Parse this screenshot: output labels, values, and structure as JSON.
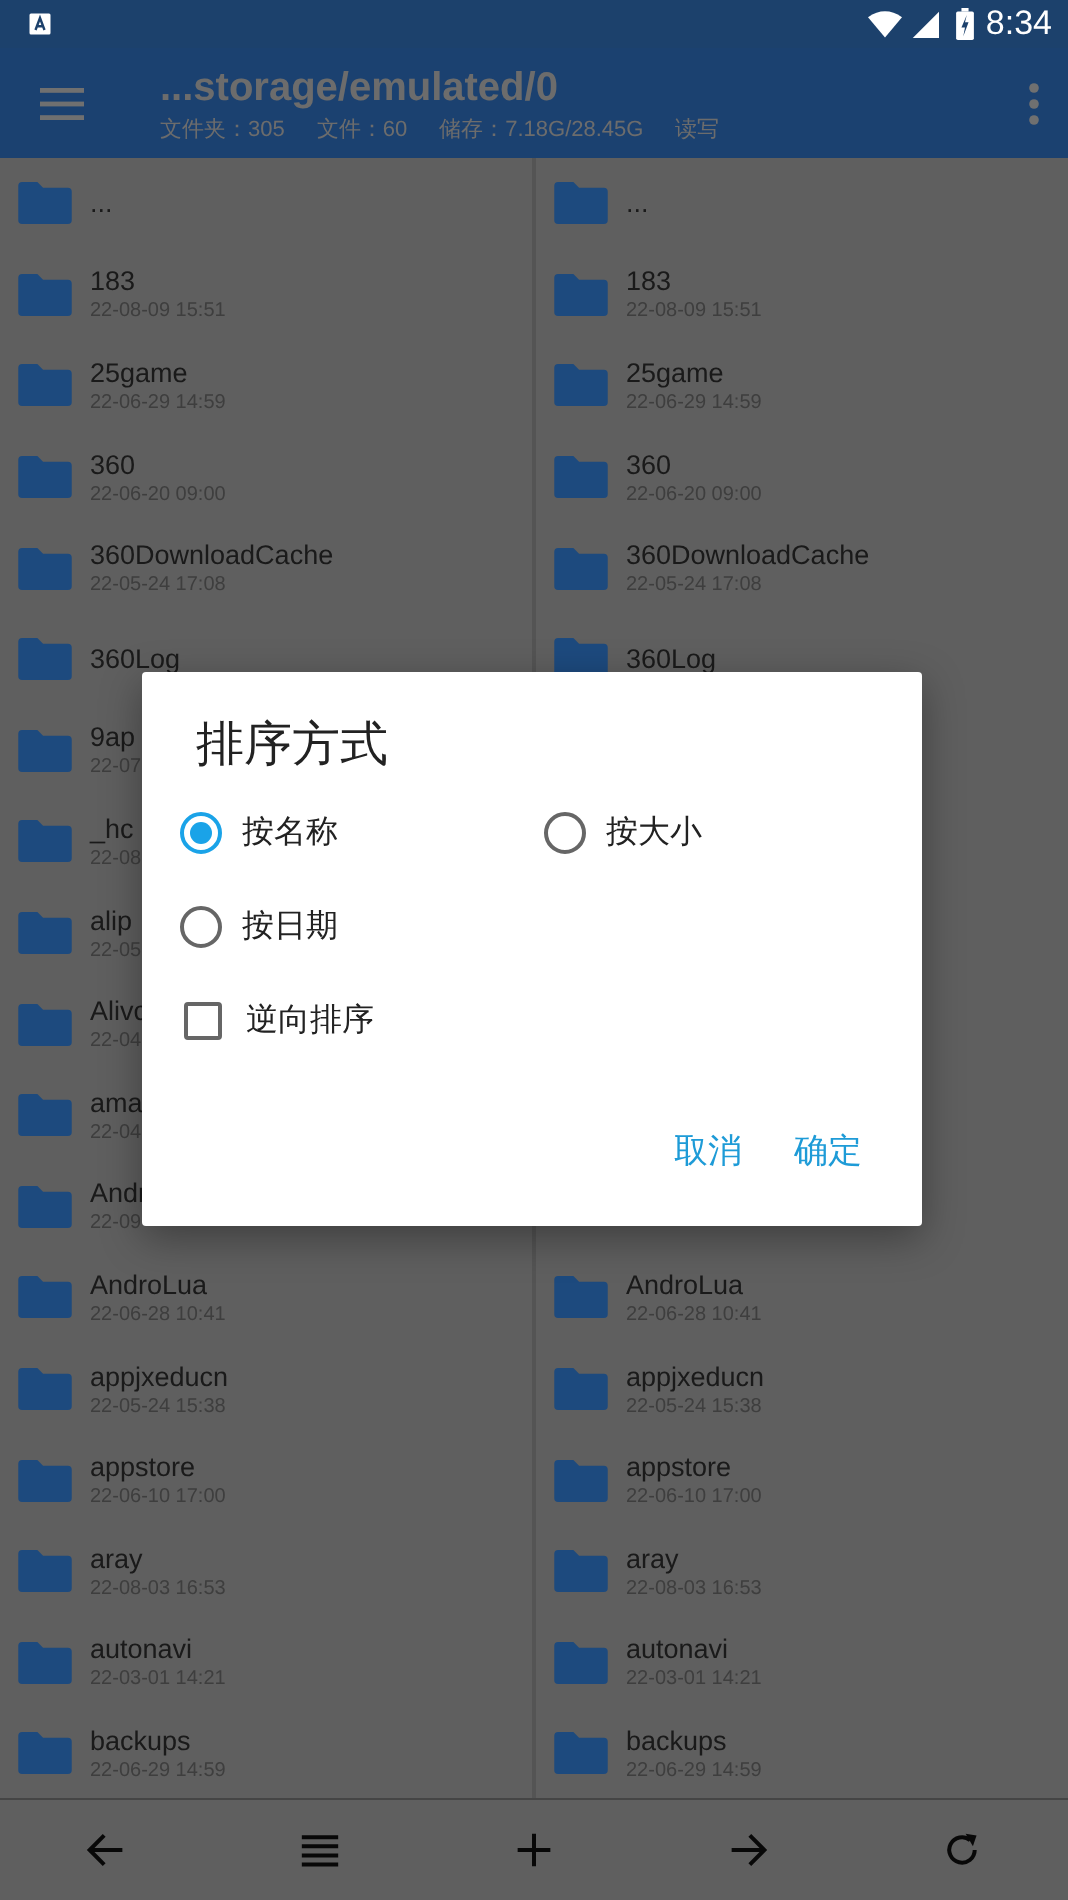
{
  "status_bar": {
    "time": "8:34"
  },
  "app_bar": {
    "title": "...storage/emulated/0",
    "stats": [
      "文件夹：305",
      "文件：60",
      "储存：7.18G/28.45G",
      "读写"
    ]
  },
  "left_pane": {
    "rows": [
      {
        "name": "..."
      },
      {
        "name": "183",
        "date": "22-08-09 15:51"
      },
      {
        "name": "25game",
        "date": "22-06-29 14:59"
      },
      {
        "name": "360",
        "date": "22-06-20 09:00"
      },
      {
        "name": "360DownloadCache",
        "date": "22-05-24 17:08"
      },
      {
        "name": "360Log"
      },
      {
        "name": "9ap",
        "date": "22-07"
      },
      {
        "name": "_hc",
        "date": "22-08"
      },
      {
        "name": "alip",
        "date": "22-05"
      },
      {
        "name": "Alivc",
        "date": "22-04"
      },
      {
        "name": "ama",
        "date": "22-04"
      },
      {
        "name": "Andr",
        "date": "22-09"
      },
      {
        "name": "AndroLua",
        "date": "22-06-28 10:41"
      },
      {
        "name": "appjxeducn",
        "date": "22-05-24 15:38"
      },
      {
        "name": "appstore",
        "date": "22-06-10 17:00"
      },
      {
        "name": "aray",
        "date": "22-08-03 16:53"
      },
      {
        "name": "autonavi",
        "date": "22-03-01 14:21"
      },
      {
        "name": "backups",
        "date": "22-06-29 14:59"
      }
    ]
  },
  "right_pane": {
    "rows_top": [
      {
        "name": "..."
      },
      {
        "name": "183",
        "date": "22-08-09 15:51"
      },
      {
        "name": "25game",
        "date": "22-06-29 14:59"
      },
      {
        "name": "360",
        "date": "22-06-20 09:00"
      },
      {
        "name": "360DownloadCache",
        "date": "22-05-24 17:08"
      },
      {
        "name": "360Log"
      }
    ],
    "rows_bottom": [
      {
        "name": "AndroLua",
        "date": "22-06-28 10:41"
      },
      {
        "name": "appjxeducn",
        "date": "22-05-24 15:38"
      },
      {
        "name": "appstore",
        "date": "22-06-10 17:00"
      },
      {
        "name": "aray",
        "date": "22-08-03 16:53"
      },
      {
        "name": "autonavi",
        "date": "22-03-01 14:21"
      },
      {
        "name": "backups",
        "date": "22-06-29 14:59"
      }
    ]
  },
  "dialog": {
    "title": "排序方式",
    "options": [
      {
        "label": "按名称",
        "selected": true
      },
      {
        "label": "按大小",
        "selected": false
      },
      {
        "label": "按日期",
        "selected": false
      }
    ],
    "reverse": {
      "label": "逆向排序",
      "checked": false
    },
    "buttons": [
      "取消",
      "确定"
    ]
  },
  "bottom_bar": {
    "buttons": [
      {
        "kind": "back"
      },
      {
        "kind": "list"
      },
      {
        "kind": "add"
      },
      {
        "kind": "forward"
      },
      {
        "kind": "refresh"
      }
    ]
  }
}
